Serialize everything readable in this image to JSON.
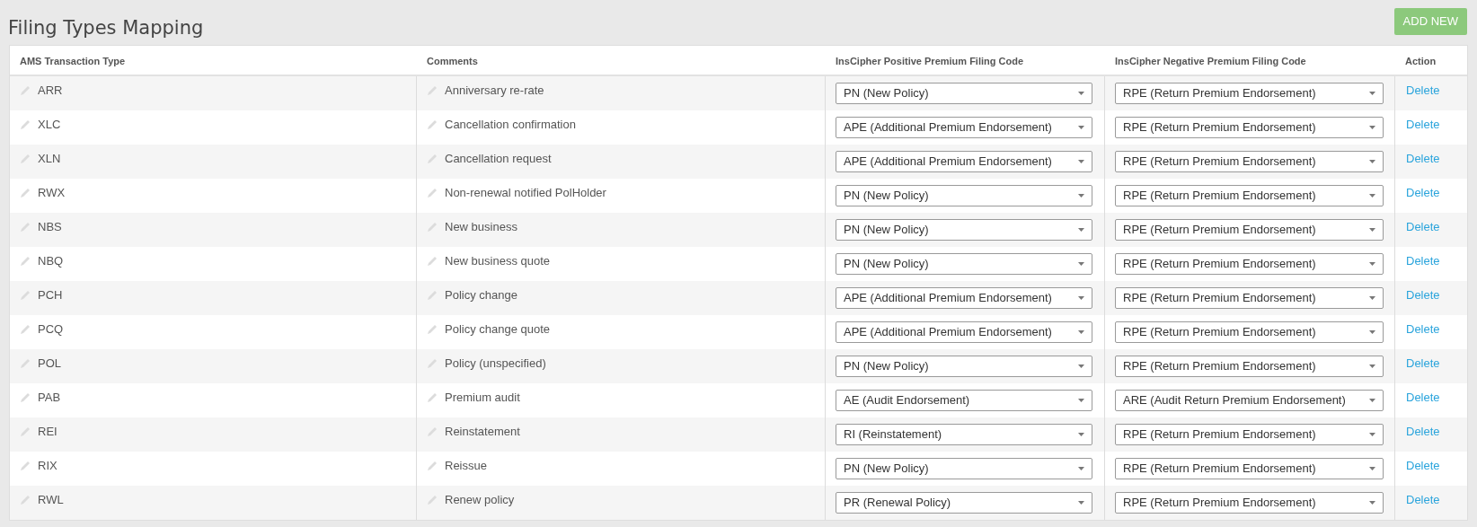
{
  "title": "Filing Types Mapping",
  "add_button": "ADD NEW",
  "columns": [
    "AMS Transaction Type",
    "Comments",
    "InsCipher Positive Premium Filing Code",
    "InsCipher Negative Premium Filing Code",
    "Action"
  ],
  "rows": [
    {
      "type": "ARR",
      "comment": "Anniversary re-rate",
      "positive": "PN (New Policy)",
      "negative": "RPE (Return Premium Endorsement)",
      "action": "Delete"
    },
    {
      "type": "XLC",
      "comment": "Cancellation confirmation",
      "positive": "APE (Additional Premium Endorsement)",
      "negative": "RPE (Return Premium Endorsement)",
      "action": "Delete"
    },
    {
      "type": "XLN",
      "comment": "Cancellation request",
      "positive": "APE (Additional Premium Endorsement)",
      "negative": "RPE (Return Premium Endorsement)",
      "action": "Delete"
    },
    {
      "type": "RWX",
      "comment": "Non-renewal notified PolHolder",
      "positive": "PN (New Policy)",
      "negative": "RPE (Return Premium Endorsement)",
      "action": "Delete"
    },
    {
      "type": "NBS",
      "comment": "New business",
      "positive": "PN (New Policy)",
      "negative": "RPE (Return Premium Endorsement)",
      "action": "Delete"
    },
    {
      "type": "NBQ",
      "comment": "New business quote",
      "positive": "PN (New Policy)",
      "negative": "RPE (Return Premium Endorsement)",
      "action": "Delete"
    },
    {
      "type": "PCH",
      "comment": "Policy change",
      "positive": "APE (Additional Premium Endorsement)",
      "negative": "RPE (Return Premium Endorsement)",
      "action": "Delete"
    },
    {
      "type": "PCQ",
      "comment": "Policy change quote",
      "positive": "APE (Additional Premium Endorsement)",
      "negative": "RPE (Return Premium Endorsement)",
      "action": "Delete"
    },
    {
      "type": "POL",
      "comment": "Policy (unspecified)",
      "positive": "PN (New Policy)",
      "negative": "RPE (Return Premium Endorsement)",
      "action": "Delete"
    },
    {
      "type": "PAB",
      "comment": "Premium audit",
      "positive": "AE (Audit Endorsement)",
      "negative": "ARE (Audit Return Premium Endorsement)",
      "action": "Delete"
    },
    {
      "type": "REI",
      "comment": "Reinstatement",
      "positive": "RI (Reinstatement)",
      "negative": "RPE (Return Premium Endorsement)",
      "action": "Delete"
    },
    {
      "type": "RIX",
      "comment": "Reissue",
      "positive": "PN (New Policy)",
      "negative": "RPE (Return Premium Endorsement)",
      "action": "Delete"
    },
    {
      "type": "RWL",
      "comment": "Renew policy",
      "positive": "PR (Renewal Policy)",
      "negative": "RPE (Return Premium Endorsement)",
      "action": "Delete"
    }
  ]
}
